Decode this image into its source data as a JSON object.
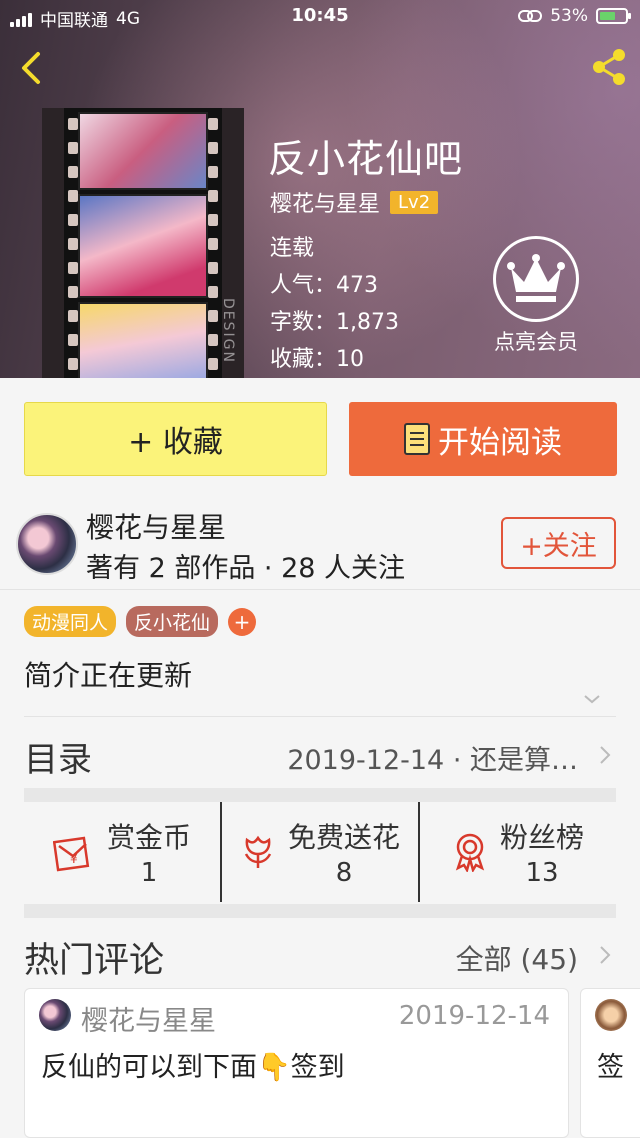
{
  "status_bar": {
    "carrier": "中国联通",
    "network": "4G",
    "time": "10:45",
    "battery": "53%"
  },
  "book": {
    "title": "反小花仙吧",
    "author": "樱花与星星",
    "level": "Lv2",
    "status": "连载",
    "popularity": "人气：473",
    "word_count": "字数：1,873",
    "favorites": "收藏：10",
    "cover_text": "DESIGN"
  },
  "member": {
    "label": "点亮会员"
  },
  "actions": {
    "favorite_label": "+ 收藏",
    "read_label": "开始阅读"
  },
  "author_info": {
    "name": "樱花与星星",
    "meta": "著有 2 部作品 · 28 人关注",
    "follow_label": "+关注"
  },
  "tags": [
    "动漫同人",
    "反小花仙"
  ],
  "tag_add": "+",
  "intro": "简介正在更新",
  "catalog": {
    "label": "目录",
    "latest": "2019-12-14 · 还是算…"
  },
  "rewards": [
    {
      "label": "赏金币",
      "value": "1",
      "icon": "red-envelope-icon"
    },
    {
      "label": "免费送花",
      "value": "8",
      "icon": "flower-icon"
    },
    {
      "label": "粉丝榜",
      "value": "13",
      "icon": "medal-icon"
    }
  ],
  "hot_comments": {
    "label": "热门评论",
    "all": "全部 (45)",
    "comments": [
      {
        "user": "樱花与星星",
        "date": "2019-12-14",
        "text": "反仙的可以到下面👇签到"
      },
      {
        "text": "签"
      }
    ]
  },
  "colors": {
    "accent_orange": "#ee6a3c",
    "favorite_yellow": "#fbf37a",
    "level_gold": "#f2b42b",
    "follow_red": "#e2553a"
  }
}
